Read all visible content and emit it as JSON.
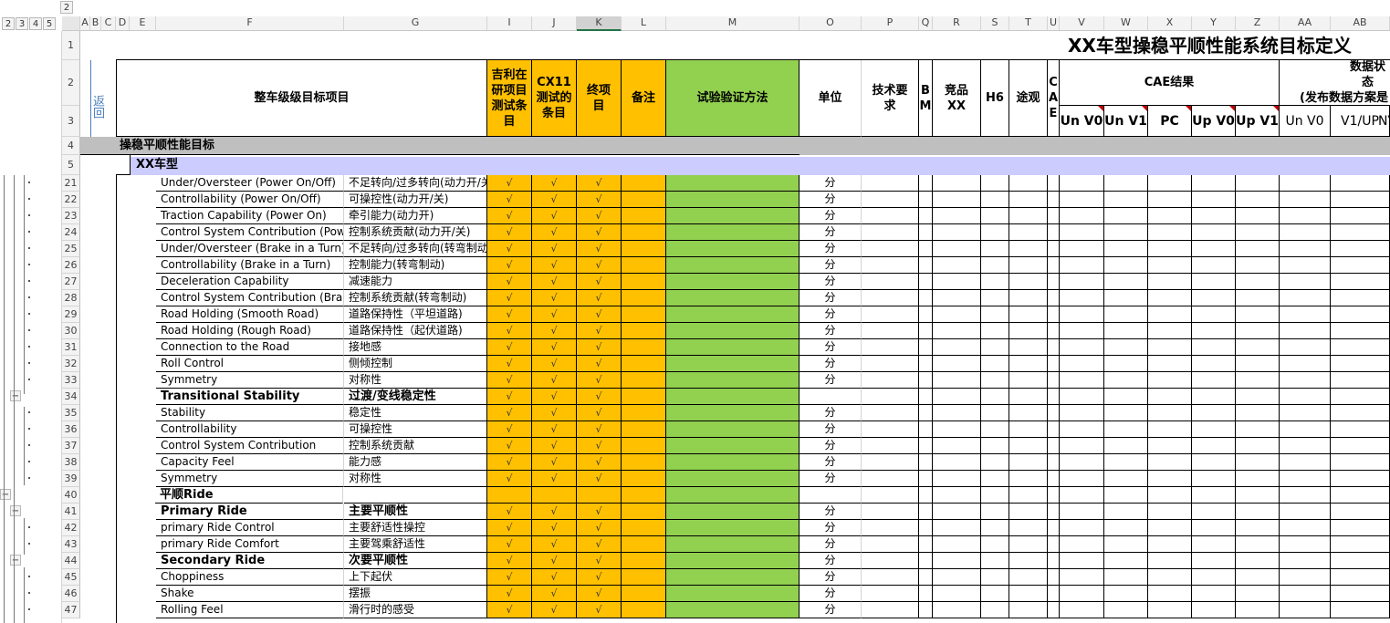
{
  "outline_levels": [
    "2",
    "3",
    "4",
    "5"
  ],
  "outline_top_level": "2",
  "columns": [
    "A",
    "B",
    "C",
    "D",
    "E",
    "F",
    "G",
    "I",
    "J",
    "K",
    "L",
    "M",
    "O",
    "P",
    "Q",
    "R",
    "S",
    "T",
    "U",
    "V",
    "W",
    "X",
    "Y",
    "Z",
    "AA",
    "AB"
  ],
  "selected_column": "K",
  "title": "XX车型操稳平顺性能系统目标定义",
  "return_link": "返回",
  "headers": {
    "item": "整车级级目标项目",
    "geely": "吉利在研项目测试条目",
    "cx11": "CX11测试的条目",
    "final": "终项目",
    "remark": "备注",
    "method": "试验验证方法",
    "unit": "单位",
    "tech": "技术要求",
    "bm": "BM",
    "comp": "竞品XX",
    "h6": "H6",
    "tuguan": "途观",
    "cae": "CAE",
    "cae_result": "CAE结果",
    "data_status": "数据状态",
    "data_status_sub": "(发布数据方案是",
    "sub": [
      "Un V0",
      "Un V1",
      "PC",
      "Up V0",
      "Up V1",
      "Un V0",
      "V1/UP",
      "NV"
    ]
  },
  "section_row": {
    "num": "4",
    "label": "操稳平顺性能目标"
  },
  "vehicle_row": {
    "num": "5",
    "label": "XX车型"
  },
  "rows": [
    {
      "num": "21",
      "en": "Under/Oversteer (Power On/Off)",
      "cn": "不足转向/过多转向(动力开/关",
      "unit": "分",
      "bold": false,
      "btn": ""
    },
    {
      "num": "22",
      "en": "Controllability (Power On/Off)",
      "cn": "可操控性(动力开/关)",
      "unit": "分",
      "bold": false,
      "btn": ""
    },
    {
      "num": "23",
      "en": "Traction Capability (Power On)",
      "cn": "牵引能力(动力开)",
      "unit": "分",
      "bold": false,
      "btn": ""
    },
    {
      "num": "24",
      "en": "Control System Contribution (Powe",
      "cn": "控制系统贡献(动力开/关)",
      "unit": "分",
      "bold": false,
      "btn": ""
    },
    {
      "num": "25",
      "en": "Under/Oversteer (Brake in a Turn)",
      "cn": "不足转向/过多转向(转弯制动",
      "unit": "分",
      "bold": false,
      "btn": ""
    },
    {
      "num": "26",
      "en": "Controllability (Brake in a Turn)",
      "cn": "控制能力(转弯制动)",
      "unit": "分",
      "bold": false,
      "btn": ""
    },
    {
      "num": "27",
      "en": "Deceleration Capability",
      "cn": "减速能力",
      "unit": "分",
      "bold": false,
      "btn": ""
    },
    {
      "num": "28",
      "en": "Control System Contribution (Brak",
      "cn": "控制系统贡献(转弯制动)",
      "unit": "分",
      "bold": false,
      "btn": ""
    },
    {
      "num": "29",
      "en": "Road Holding (Smooth Road)",
      "cn": "道路保持性（平坦道路)",
      "unit": "分",
      "bold": false,
      "btn": ""
    },
    {
      "num": "30",
      "en": "Road Holding (Rough Road)",
      "cn": "道路保持性（起伏道路)",
      "unit": "分",
      "bold": false,
      "btn": ""
    },
    {
      "num": "31",
      "en": "Connection to the Road",
      "cn": "接地感",
      "unit": "分",
      "bold": false,
      "btn": ""
    },
    {
      "num": "32",
      "en": "Roll Control",
      "cn": "侧倾控制",
      "unit": "分",
      "bold": false,
      "btn": ""
    },
    {
      "num": "33",
      "en": "Symmetry",
      "cn": "对称性",
      "unit": "分",
      "bold": false,
      "btn": ""
    },
    {
      "num": "34",
      "en": "Transitional Stability",
      "cn": "过渡/变线稳定性",
      "unit": "",
      "bold": true,
      "btn": "−"
    },
    {
      "num": "35",
      "en": "Stability",
      "cn": "稳定性",
      "unit": "分",
      "bold": false,
      "btn": ""
    },
    {
      "num": "36",
      "en": "Controllability",
      "cn": "可操控性",
      "unit": "分",
      "bold": false,
      "btn": ""
    },
    {
      "num": "37",
      "en": "Control System Contribution",
      "cn": "控制系统贡献",
      "unit": "分",
      "bold": false,
      "btn": ""
    },
    {
      "num": "38",
      "en": "Capacity Feel",
      "cn": "能力感",
      "unit": "分",
      "bold": false,
      "btn": ""
    },
    {
      "num": "39",
      "en": "Symmetry",
      "cn": "对称性",
      "unit": "分",
      "bold": false,
      "btn": ""
    },
    {
      "num": "40",
      "en": "平顺Ride",
      "cn": "",
      "unit": "",
      "bold": true,
      "btn": "−",
      "level": "top"
    },
    {
      "num": "41",
      "en": "Primary Ride",
      "cn": "主要平顺性",
      "unit": "分",
      "bold": true,
      "btn": "−"
    },
    {
      "num": "42",
      "en": "primary Ride Control",
      "cn": "主要舒适性操控",
      "unit": "分",
      "bold": false,
      "btn": ""
    },
    {
      "num": "43",
      "en": "primary Ride Comfort",
      "cn": "主要驾乘舒适性",
      "unit": "分",
      "bold": false,
      "btn": ""
    },
    {
      "num": "44",
      "en": "Secondary Ride",
      "cn": "次要平顺性",
      "unit": "分",
      "bold": true,
      "btn": "−"
    },
    {
      "num": "45",
      "en": "Choppiness",
      "cn": "上下起伏",
      "unit": "分",
      "bold": false,
      "btn": ""
    },
    {
      "num": "46",
      "en": "Shake",
      "cn": "摆振",
      "unit": "分",
      "bold": false,
      "btn": ""
    },
    {
      "num": "47",
      "en": "Rolling Feel",
      "cn": "滑行时的感受",
      "unit": "分",
      "bold": false,
      "btn": ""
    }
  ],
  "check_mark": "√"
}
